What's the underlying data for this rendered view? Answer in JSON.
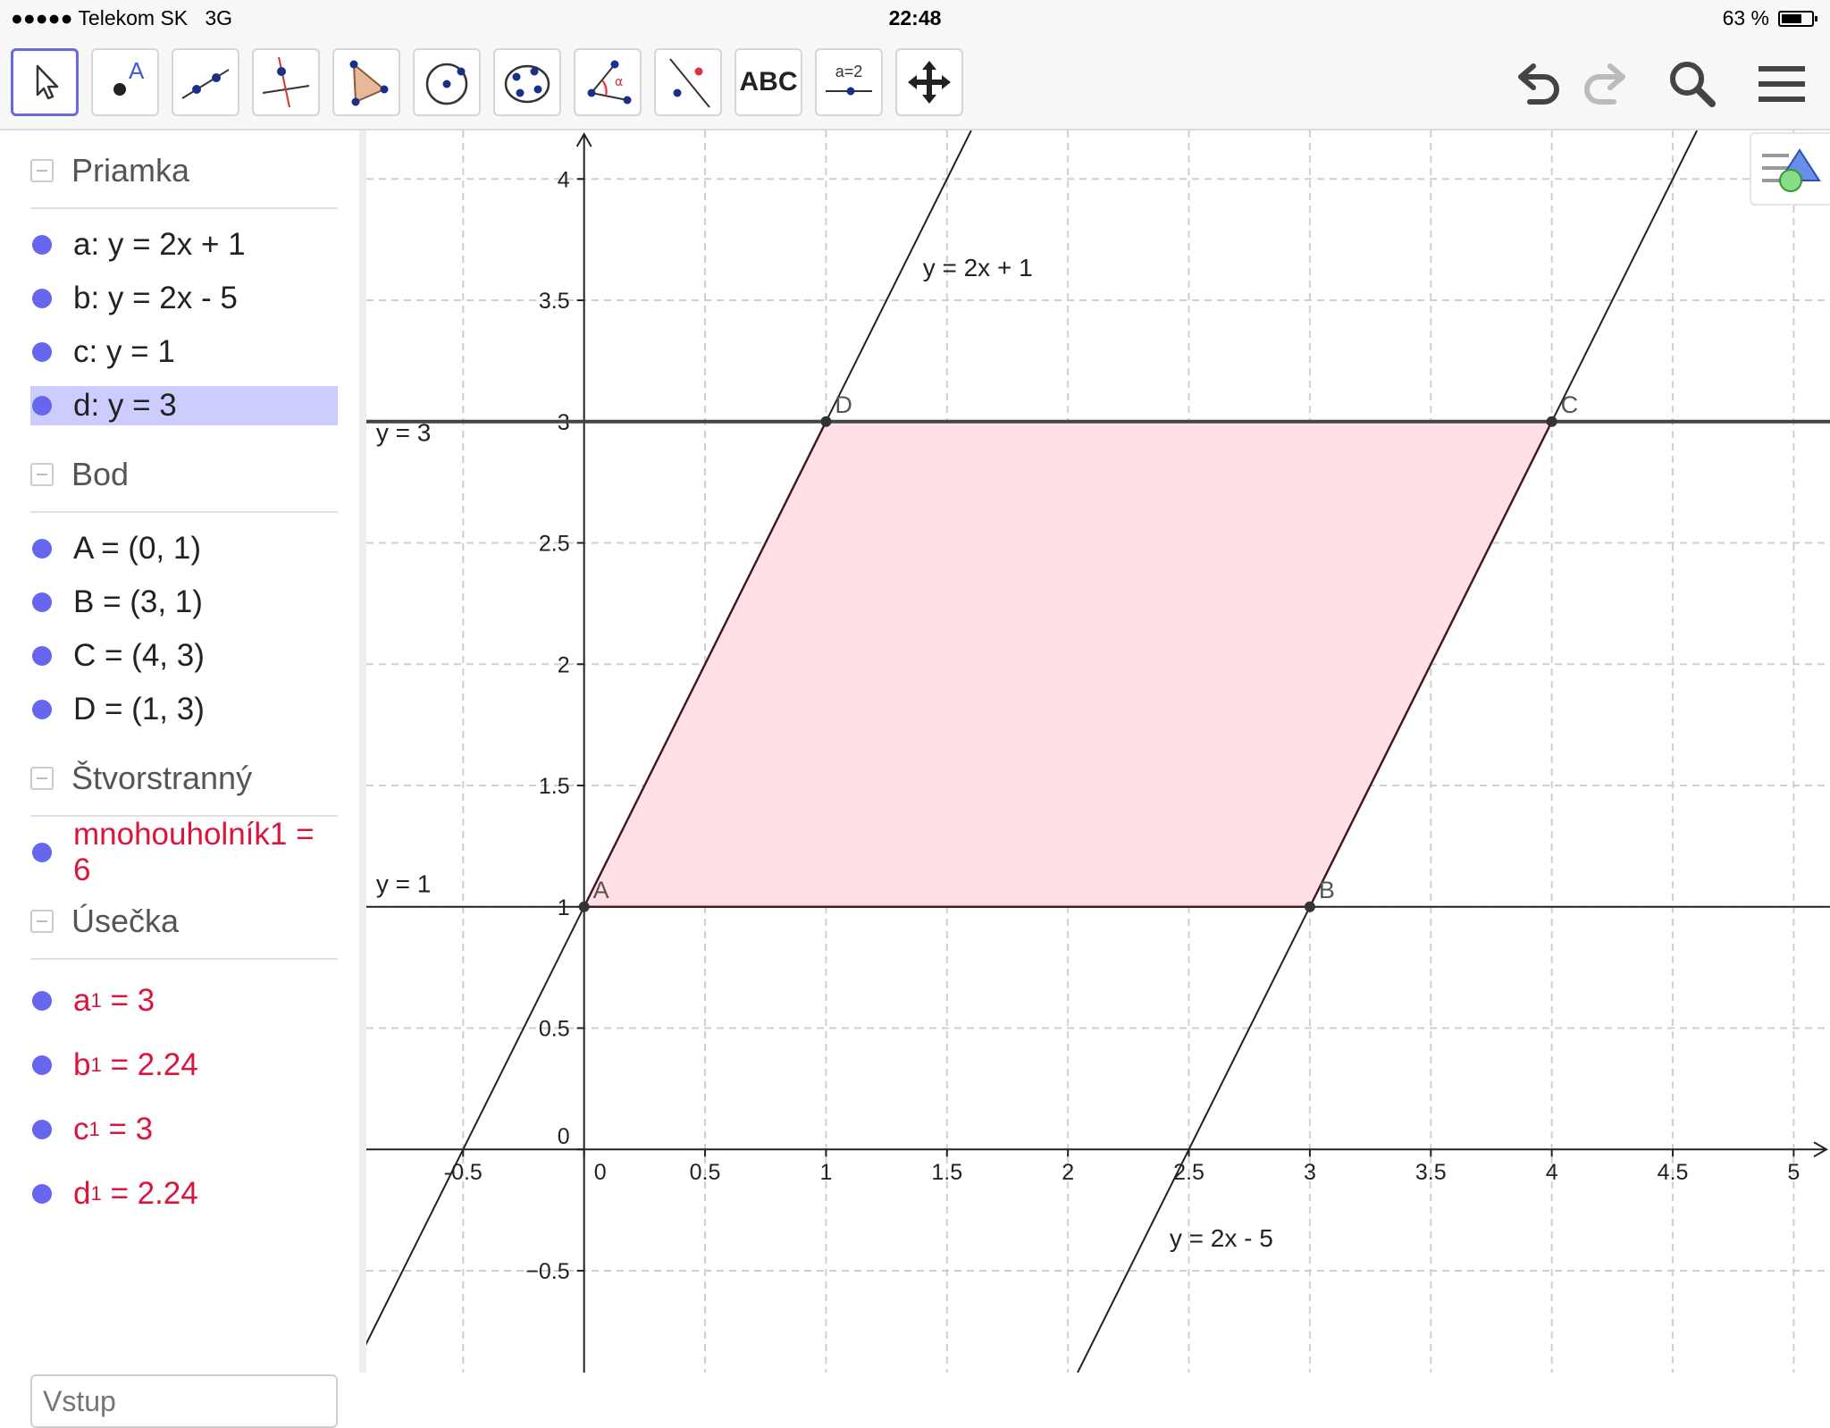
{
  "status": {
    "carrier": "●●●●● Telekom SK",
    "network": "3G",
    "time": "22:48",
    "battery": "63 %",
    "battery_level": 0.63
  },
  "toolbar": {
    "tools": [
      "move-tool",
      "point-tool",
      "line-tool",
      "perpendicular-line-tool",
      "polygon-tool",
      "circle-tool",
      "conic-tool",
      "angle-tool",
      "reflect-tool",
      "text-tool",
      "slider-tool",
      "move-graphics-view-tool"
    ],
    "text_tool_label": "ABC",
    "slider_tool_label": "a=2"
  },
  "algebra": {
    "sections": [
      {
        "title": "Priamka",
        "items": [
          {
            "text": "a: y = 2x + 1"
          },
          {
            "text": "b: y = 2x - 5"
          },
          {
            "text": "c: y = 1"
          },
          {
            "text": "d: y = 3",
            "selected": true
          }
        ]
      },
      {
        "title": "Bod",
        "items": [
          {
            "text": "A = (0, 1)"
          },
          {
            "text": "B = (3, 1)"
          },
          {
            "text": "C = (4, 3)"
          },
          {
            "text": "D = (1, 3)"
          }
        ]
      },
      {
        "title": "Štvorstranný",
        "items": [
          {
            "text": "mnohouholník1 = 6",
            "color": "#dc143c"
          }
        ]
      },
      {
        "title": "Úsečka",
        "items": [
          {
            "name": "a",
            "sub": "1",
            "value": " = 3",
            "color": "#dc143c"
          },
          {
            "name": "b",
            "sub": "1",
            "value": " = 2.24",
            "color": "#dc143c"
          },
          {
            "name": "c",
            "sub": "1",
            "value": " = 3",
            "color": "#dc143c"
          },
          {
            "name": "d",
            "sub": "1",
            "value": " = 2.24",
            "color": "#dc143c"
          }
        ]
      }
    ],
    "input_placeholder": "Vstup"
  },
  "graph": {
    "x_range": [
      -0.9,
      5.15
    ],
    "y_range": [
      -0.92,
      4.2
    ],
    "x_ticks": [
      -0.5,
      0,
      0.5,
      1,
      1.5,
      2,
      2.5,
      3,
      3.5,
      4,
      4.5,
      5
    ],
    "x_tick_labels": [
      "-0.5",
      "0",
      "0.5",
      "1",
      "1.5",
      "2",
      "2.5",
      "3",
      "3.5",
      "4",
      "4.5",
      "5"
    ],
    "y_ticks": [
      -0.5,
      0,
      0.5,
      1,
      1.5,
      2,
      2.5,
      3,
      3.5,
      4
    ],
    "y_tick_labels": [
      "−0.5",
      "0",
      "0.5",
      "1",
      "1.5",
      "2",
      "2.5",
      "3",
      "3.5",
      "4"
    ],
    "lines": [
      {
        "name": "a",
        "slope": 2,
        "intercept": 1,
        "label": "y = 2x + 1",
        "label_at": [
          1.4,
          3.6
        ]
      },
      {
        "name": "b",
        "slope": 2,
        "intercept": -5,
        "label": "y = 2x - 5",
        "label_at": [
          2.42,
          -0.4
        ]
      },
      {
        "name": "c",
        "slope": 0,
        "intercept": 1,
        "label": "y = 1",
        "label_at": [
          -0.86,
          1.06
        ]
      },
      {
        "name": "d",
        "slope": 0,
        "intercept": 3,
        "label": "y = 3",
        "label_at": [
          -0.86,
          2.92
        ],
        "highlight": true
      }
    ],
    "polygon": {
      "name": "mnohouholník1",
      "vertices": [
        [
          0,
          1
        ],
        [
          3,
          1
        ],
        [
          4,
          3
        ],
        [
          1,
          3
        ]
      ],
      "fill": "#ffe0e6",
      "stroke": "#dc143c"
    },
    "points": [
      {
        "name": "A",
        "x": 0,
        "y": 1
      },
      {
        "name": "B",
        "x": 3,
        "y": 1
      },
      {
        "name": "C",
        "x": 4,
        "y": 3
      },
      {
        "name": "D",
        "x": 1,
        "y": 3
      }
    ],
    "grid": true
  }
}
